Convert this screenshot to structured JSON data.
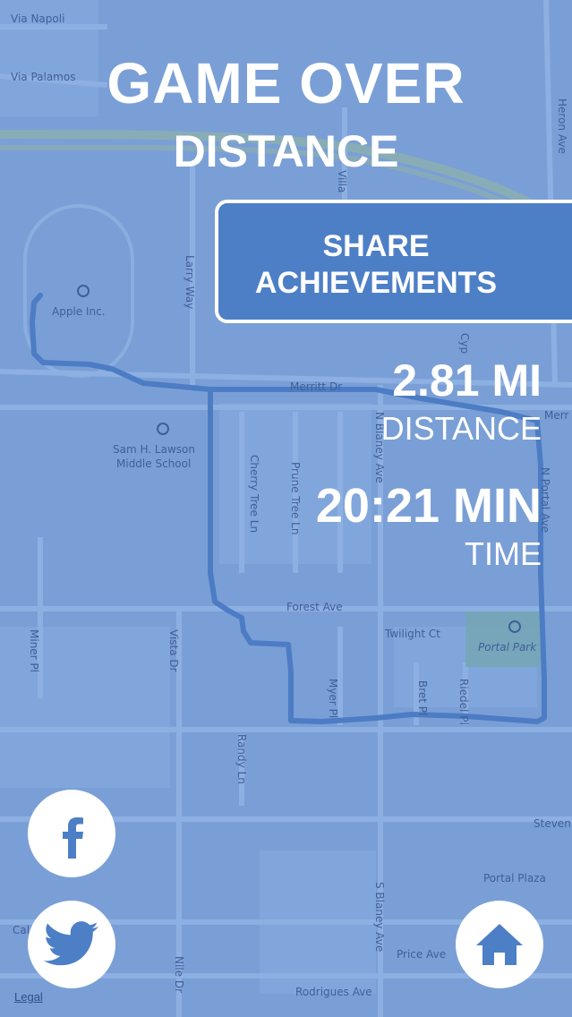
{
  "colors": {
    "background": "#7a9fd6",
    "route": "#4c7cc4",
    "button": "#4d7fc6",
    "text": "#ffffff"
  },
  "header": {
    "title": "GAME OVER",
    "mode": "DISTANCE"
  },
  "share_button": {
    "label_line1": "SHARE",
    "label_line2": "ACHIEVEMENTS"
  },
  "stats": {
    "distance_value": "2.81 MI",
    "distance_label": "DISTANCE",
    "time_value": "20:21 MIN",
    "time_label": "TIME"
  },
  "map_labels": {
    "via_napoli": "Via Napoli",
    "via_palamos": "Via Palamos",
    "heron_ave": "Heron Ave",
    "villa": "Villa",
    "apple": "Apple Inc.",
    "larry_way": "Larry Way",
    "sam_lawson_1": "Sam H. Lawson",
    "sam_lawson_2": "Middle School",
    "merritt": "Merritt Dr",
    "cherry": "Cherry Tree Ln",
    "prune": "Prune Tree Ln",
    "blaney_top": "N Blaney Ave",
    "n_portal": "N Portal Ave",
    "merr": "Merr",
    "cyp": "Cyp",
    "forest": "Forest Ave",
    "twilight": "Twilight Ct",
    "portal_park": "Portal Park",
    "miner": "Miner Pl",
    "vista": "Vista Dr",
    "myer": "Myer Pl",
    "bret": "Bret Pl",
    "riedel": "Riedel Pl",
    "randy": "Randy Ln",
    "stevens": "Steven",
    "s_blaney": "S Blaney Ave",
    "portal_plaza": "Portal Plaza",
    "price": "Price Ave",
    "nile": "Nile Dr",
    "rodrigues": "Rodrigues Ave",
    "cal": "Cal"
  },
  "social": {
    "facebook_icon": "facebook-icon",
    "twitter_icon": "twitter-icon",
    "home_icon": "home-icon"
  },
  "legal": "Legal"
}
